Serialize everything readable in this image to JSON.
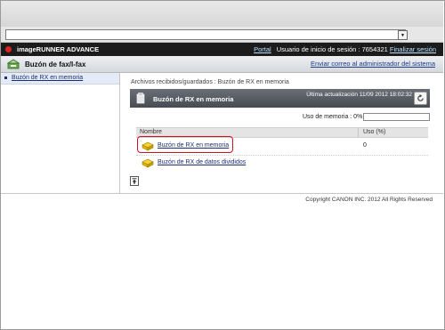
{
  "browser": {
    "address_value": "",
    "dropdown_glyph": "▼"
  },
  "brand": {
    "name": "imageRUNNER ADVANCE",
    "portal_link": "Portal",
    "login_label": "Usuario de inicio de sesión : 7654321",
    "logout_link": "Finalizar sesión"
  },
  "header": {
    "title": "Buzón de fax/I-fax",
    "admin_link": "Enviar correo al administrador del sistema"
  },
  "sidebar": {
    "items": [
      {
        "label": "Buzón de RX en memoria"
      }
    ]
  },
  "main": {
    "breadcrumb": "Archivos recibidos/guardados : Buzón de RX en memoria",
    "panel_title": "Buzón de RX en memoria",
    "last_update": "Última actualización     11/09 2012 18:02:32",
    "memory_usage_label": "Uso de memoria : 0%",
    "memory_usage_fraction": 0,
    "columns": {
      "name": "Nombre",
      "usage": "Uso (%)"
    },
    "rows": [
      {
        "name": "Buzón de RX en memoria",
        "usage": "0"
      },
      {
        "name": "Buzón de RX de datos divididos",
        "usage": ""
      }
    ]
  },
  "footer": {
    "copyright": "Copyright CANON INC. 2012 All Rights Reserved"
  },
  "colors": {
    "brand_bar": "#1c1c1c",
    "panel_header": "#55595f",
    "link": "#1c2f74",
    "highlight": "#d01020"
  }
}
